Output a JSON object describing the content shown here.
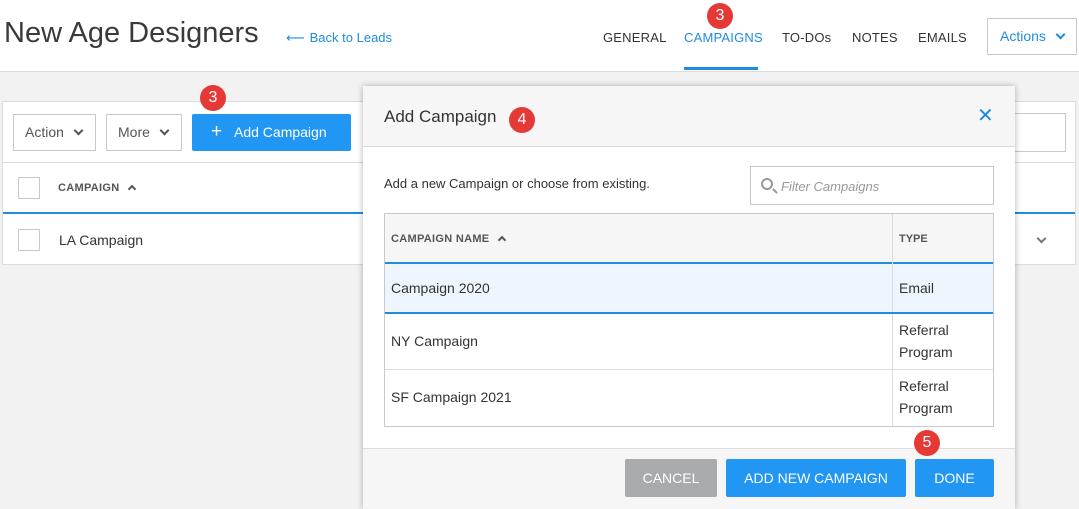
{
  "header": {
    "title": "New Age Designers",
    "back_link": "Back to Leads",
    "back_arrow": "⟵",
    "nav": [
      {
        "label": "GENERAL",
        "active": false
      },
      {
        "label": "CAMPAIGNS",
        "active": true
      },
      {
        "label": "TO-DOs",
        "active": false
      },
      {
        "label": "NOTES",
        "active": false
      },
      {
        "label": "EMAILS",
        "active": false
      }
    ],
    "actions_label": "Actions"
  },
  "toolbar": {
    "action_label": "Action",
    "more_label": "More",
    "add_campaign_label": "Add Campaign",
    "add_icon": "+"
  },
  "table": {
    "column_header": "CAMPAIGN",
    "rows": [
      {
        "name": "LA Campaign"
      }
    ]
  },
  "modal": {
    "title": "Add Campaign",
    "close_icon": "✕",
    "description": "Add a new Campaign or choose from existing.",
    "filter_placeholder": "Filter Campaigns",
    "columns": {
      "name": "CAMPAIGN NAME",
      "type": "TYPE"
    },
    "rows": [
      {
        "name": "Campaign 2020",
        "type": "Email",
        "selected": true
      },
      {
        "name": "NY Campaign",
        "type": "Referral Program",
        "selected": false
      },
      {
        "name": "SF Campaign 2021",
        "type": "Referral Program",
        "selected": false
      }
    ],
    "buttons": {
      "cancel": "CANCEL",
      "add_new": "ADD NEW CAMPAIGN",
      "done": "DONE"
    }
  },
  "step_badges": {
    "campaigns_tab": "3",
    "add_campaign": "3",
    "modal_title": "4",
    "done": "5"
  },
  "colors": {
    "accent": "#2196f3",
    "link": "#1f8ce0",
    "badge": "#e53935",
    "cancel": "#a8aaac"
  }
}
